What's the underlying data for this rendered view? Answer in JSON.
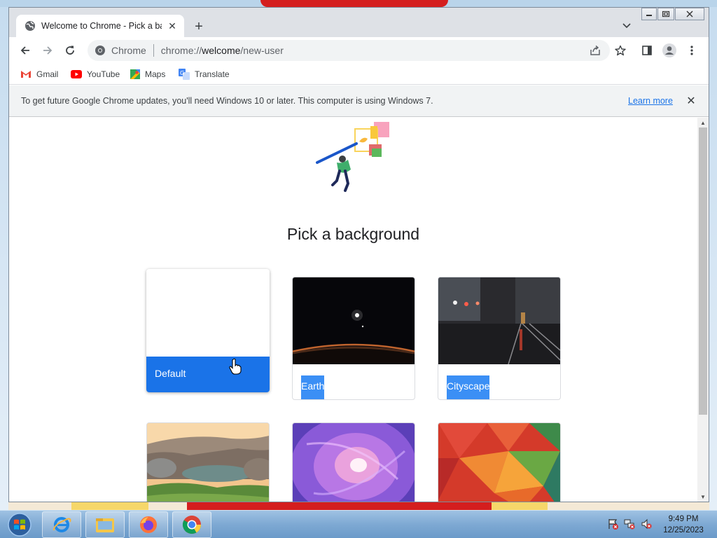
{
  "browser": {
    "tab_title": "Welcome to Chrome - Pick a background",
    "address": {
      "site_label": "Chrome",
      "url_scheme": "chrome://",
      "url_host": "welcome",
      "url_path": "/new-user"
    },
    "bookmarks": [
      {
        "label": "Gmail",
        "icon": "gmail-icon"
      },
      {
        "label": "YouTube",
        "icon": "youtube-icon"
      },
      {
        "label": "Maps",
        "icon": "maps-icon"
      },
      {
        "label": "Translate",
        "icon": "translate-icon"
      }
    ],
    "infobar": {
      "message": "To get future Google Chrome updates, you'll need Windows 10 or later. This computer is using Windows 7.",
      "link": "Learn more"
    }
  },
  "page": {
    "heading": "Pick a background",
    "backgrounds": [
      {
        "label": "Default",
        "selected": true
      },
      {
        "label": "Earth",
        "selected": false
      },
      {
        "label": "Cityscape",
        "selected": false
      },
      {
        "label": "",
        "selected": false
      },
      {
        "label": "",
        "selected": false
      },
      {
        "label": "",
        "selected": false
      }
    ]
  },
  "taskbar": {
    "time": "9:49 PM",
    "date": "12/25/2023",
    "pinned": [
      "internet-explorer-icon",
      "folder-icon",
      "firefox-icon",
      "chrome-icon"
    ]
  },
  "colors": {
    "accent": "#1a73e8",
    "label_bg": "#3b8ff5"
  }
}
